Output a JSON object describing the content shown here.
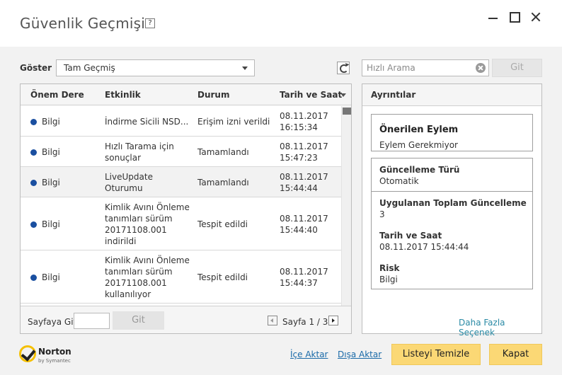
{
  "window": {
    "title": "Güvenlik Geçmişi",
    "help_label": "?"
  },
  "filter": {
    "label": "Göster",
    "selected": "Tam Geçmiş"
  },
  "search": {
    "placeholder": "Hızlı Arama",
    "go_label": "Git"
  },
  "table": {
    "columns": [
      "Önem Dere",
      "Etkinlik",
      "Durum",
      "Tarih ve Saat"
    ],
    "rows": [
      {
        "severity": "Bilgi",
        "activity": "İndirme Sicili NSD...",
        "status": "Erişim izni verildi",
        "date": "08.11.2017",
        "time": "16:15:34"
      },
      {
        "severity": "Bilgi",
        "activity_lines": [
          "Hızlı Tarama için",
          "sonuçlar"
        ],
        "status": "Tamamlandı",
        "date": "08.11.2017",
        "time": "15:47:23"
      },
      {
        "severity": "Bilgi",
        "activity_lines": [
          "LiveUpdate",
          "Oturumu"
        ],
        "status": "Tamamlandı",
        "date": "08.11.2017",
        "time": "15:44:44"
      },
      {
        "severity": "Bilgi",
        "activity_lines": [
          "Kimlik Avını Önleme",
          "tanımları sürüm",
          "20171108.001",
          "indirildi"
        ],
        "status": "Tespit edildi",
        "date": "08.11.2017",
        "time": "15:44:40"
      },
      {
        "severity": "Bilgi",
        "activity_lines": [
          "Kimlik Avını Önleme",
          "tanımları sürüm",
          "20171108.001",
          "kullanılıyor"
        ],
        "status": "Tespit edildi",
        "date": "08.11.2017",
        "time": "15:44:37"
      }
    ]
  },
  "pager": {
    "goto_label": "Sayfaya Git:",
    "goto_button": "Git",
    "page_info": "Sayfa 1 / 3"
  },
  "details": {
    "title": "Ayrıntılar",
    "recommended_action_label": "Önerilen Eylem",
    "recommended_action_value": "Eylem Gerekmiyor",
    "update_type_label": "Güncelleme Türü",
    "update_type_value": "Otomatik",
    "total_updates_label": "Uygulanan Toplam Güncelleme",
    "total_updates_value": "3",
    "datetime_label": "Tarih ve Saat",
    "datetime_value": "08.11.2017 15:44:44",
    "risk_label": "Risk",
    "risk_value": "Bilgi",
    "more_options": "Daha Fazla Seçenek"
  },
  "footer": {
    "brand": "Norton",
    "brand_sub": "by Symantec",
    "import_label": "İçe Aktar",
    "export_label": "Dışa Aktar",
    "clear_list_label": "Listeyi Temizle",
    "close_label": "Kapat"
  },
  "colors": {
    "accent_yellow": "#fbd875",
    "info_dot": "#1a4fa0",
    "link": "#1a6aa8"
  }
}
